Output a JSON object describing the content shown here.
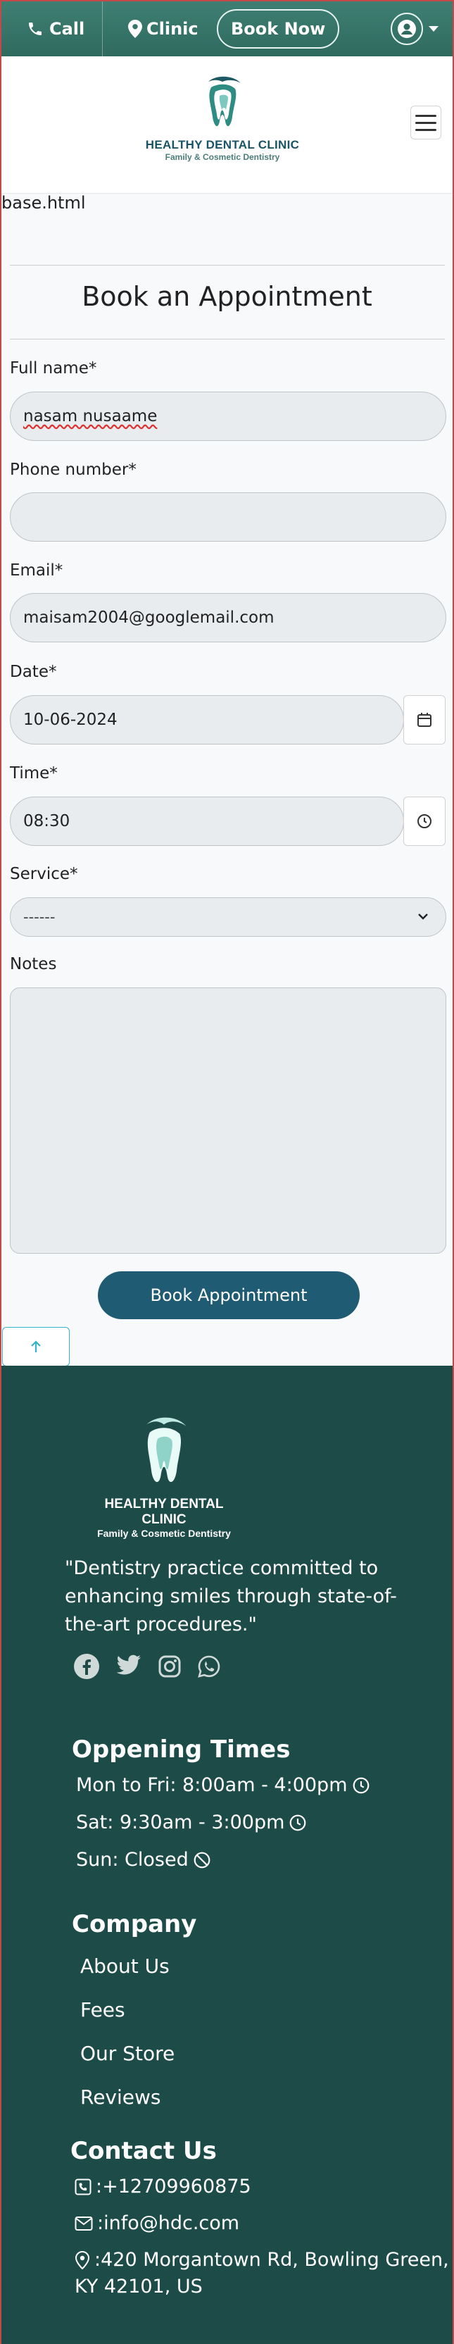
{
  "topbar": {
    "call_label": "Call",
    "clinic_label": "Clinic",
    "book_now_label": "Book Now"
  },
  "header": {
    "logo_name": "HEALTHY DENTAL CLINIC",
    "logo_sub": "Family & Cosmetic Dentistry"
  },
  "base_text": "base.html",
  "form": {
    "title": "Book an Appointment",
    "full_name_label": "Full name*",
    "full_name_value": "nasam nusaame",
    "phone_label": "Phone number*",
    "phone_value": "",
    "email_label": "Email*",
    "email_value": "maisam2004@googlemail.com",
    "date_label": "Date*",
    "date_value": "10-06-2024",
    "time_label": "Time*",
    "time_value": "08:30",
    "service_label": "Service*",
    "service_value": "------",
    "notes_label": "Notes",
    "submit_label": "Book Appointment"
  },
  "footer": {
    "logo_name": "HEALTHY DENTAL CLINIC",
    "logo_sub": "Family & Cosmetic Dentistry",
    "tagline": "\"Dentistry practice committed to enhancing smiles through state-of-the-art procedures.\"",
    "opening_title": "Oppening Times",
    "hours_weekday": "Mon to Fri: 8:00am - 4:00pm",
    "hours_sat": "Sat: 9:30am - 3:00pm",
    "hours_sun": "Sun: Closed",
    "company_title": "Company",
    "links": [
      "About Us",
      "Fees",
      "Our Store",
      "Reviews"
    ],
    "contact_title": "Contact Us",
    "phone": ":+12709960875",
    "email": ":info@hdc.com",
    "address_line1": ":420 Morgantown Rd, Bowling Green,",
    "address_line2": "KY 42101, US"
  },
  "colors": {
    "topbar": "#2f6a5f",
    "footer": "#1d4c48",
    "submit": "#1f5b73"
  }
}
